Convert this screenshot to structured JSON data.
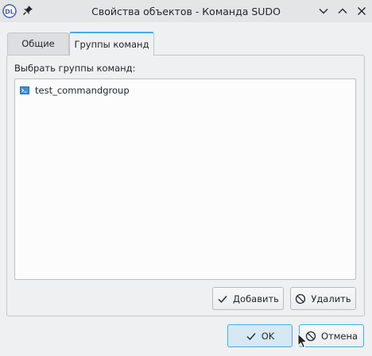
{
  "window": {
    "title": "Свойства объектов - Команда SUDO",
    "app_icon": "dl-app-icon",
    "controls": [
      "pin-icon",
      "minimize-icon",
      "maximize-icon",
      "close-icon"
    ]
  },
  "tabs": [
    {
      "label": "Общие",
      "active": false
    },
    {
      "label": "Группы команд",
      "active": true
    }
  ],
  "main": {
    "section_label": "Выбрать группы команд:",
    "items": [
      {
        "label": "test_commandgroup",
        "icon": "command-group-icon"
      }
    ],
    "add_label": "Добавить",
    "remove_label": "Удалить"
  },
  "footer": {
    "ok_label": "OK",
    "cancel_label": "Отмена"
  },
  "colors": {
    "accent": "#3daee9",
    "window_bg": "#eff0f1",
    "titlebar_bg": "#e3e5e7"
  }
}
